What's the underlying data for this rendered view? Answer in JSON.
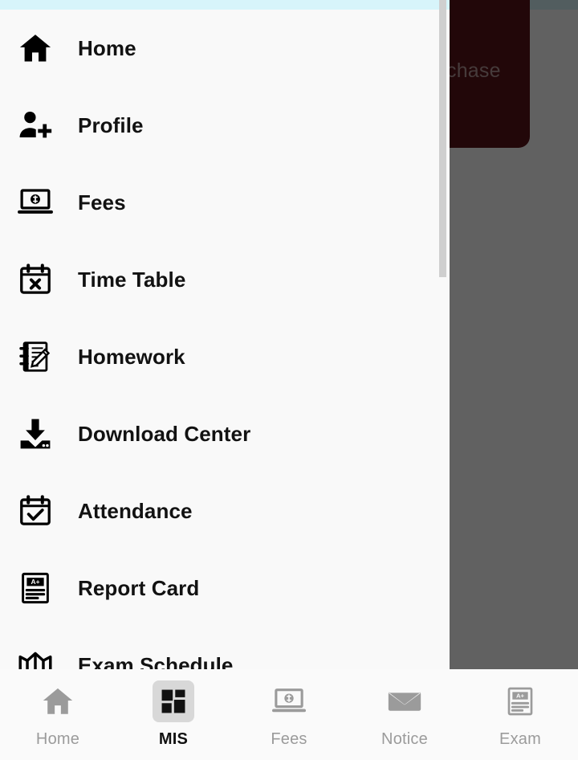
{
  "theme": {
    "status_strip_color": "#d7f4fa",
    "drawer_bg": "#f9f9f9",
    "scrim_color": "#626262",
    "promo_card_color": "#5b1419",
    "active_tab_bg": "#d8d8d8",
    "inactive_icon_color": "#9b9b9b",
    "label_color": "#121212"
  },
  "underlying_page": {
    "promo_card": {
      "visible_text": "chase",
      "icon": "promo-card"
    }
  },
  "drawer": {
    "scrollbar": {
      "icon": "scrollbar-thumb"
    },
    "items": [
      {
        "label": "Home",
        "icon": "home-icon"
      },
      {
        "label": "Profile",
        "icon": "person-add-icon"
      },
      {
        "label": "Fees",
        "icon": "laptop-money-icon"
      },
      {
        "label": "Time Table",
        "icon": "calendar-x-icon"
      },
      {
        "label": "Homework",
        "icon": "notepad-pencil-icon"
      },
      {
        "label": "Download Center",
        "icon": "download-tray-icon"
      },
      {
        "label": "Attendance",
        "icon": "calendar-check-icon"
      },
      {
        "label": "Report Card",
        "icon": "report-card-icon"
      },
      {
        "label": "Exam Schedule",
        "icon": "open-book-icon"
      }
    ]
  },
  "bottom_nav": {
    "tabs": [
      {
        "label": "Home",
        "icon": "home-icon",
        "active": false
      },
      {
        "label": "MIS",
        "icon": "grid-icon",
        "active": true
      },
      {
        "label": "Fees",
        "icon": "laptop-money-icon",
        "active": false
      },
      {
        "label": "Notice",
        "icon": "envelope-icon",
        "active": false
      },
      {
        "label": "Exam",
        "icon": "report-card-icon",
        "active": false
      }
    ]
  }
}
